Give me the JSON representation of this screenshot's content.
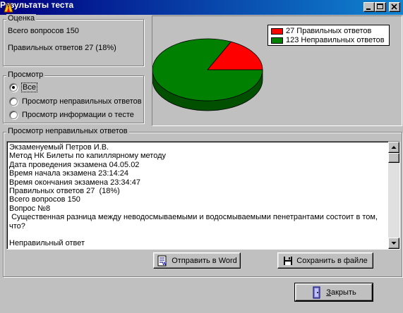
{
  "window": {
    "title": "Результаты теста"
  },
  "score": {
    "legend": "Оценка",
    "total_label": "Всего вопросов 150",
    "correct_label": "Правильных ответов 27  (18%)"
  },
  "view": {
    "legend": "Просмотр",
    "options": [
      {
        "label": "Все",
        "checked": true
      },
      {
        "label": "Просмотр неправильных ответов",
        "checked": false
      },
      {
        "label": "Просмотр информации о тесте",
        "checked": false
      }
    ]
  },
  "chart_data": {
    "type": "pie",
    "categories": [
      "Правильных ответов",
      "Неправильных ответов"
    ],
    "values": [
      27,
      123
    ],
    "legend": [
      "27 Правильных ответов",
      "123 Неправильных ответов"
    ],
    "colors": [
      "#ff0000",
      "#008000"
    ],
    "legend_position": "top-right"
  },
  "answers": {
    "legend": "Просмотр неправильных ответов",
    "lines": [
      "Экзаменуемый Петров И.В.",
      "Метод НК Билеты по капиллярному методу",
      "Дата проведения экзамена 04.05.02",
      "Время начала экзамена 23:14:24",
      "Время окончания экзамена 23:34:47",
      "Правильных ответов 27  (18%)",
      "Всего вопросов 150",
      "Вопрос №8",
      " Существенная разница между неводосмываемыми и водосмываемыми пенетрантами состоит в том, что?",
      "",
      "Неправильный ответ"
    ]
  },
  "actions": {
    "send_word": "Отправить в Word",
    "save_file": "Сохранить в файле",
    "close": "Закрыть"
  },
  "icons": {
    "app": "app-icon",
    "word": "word-document-icon",
    "save": "floppy-disk-icon",
    "close": "door-exit-icon"
  }
}
